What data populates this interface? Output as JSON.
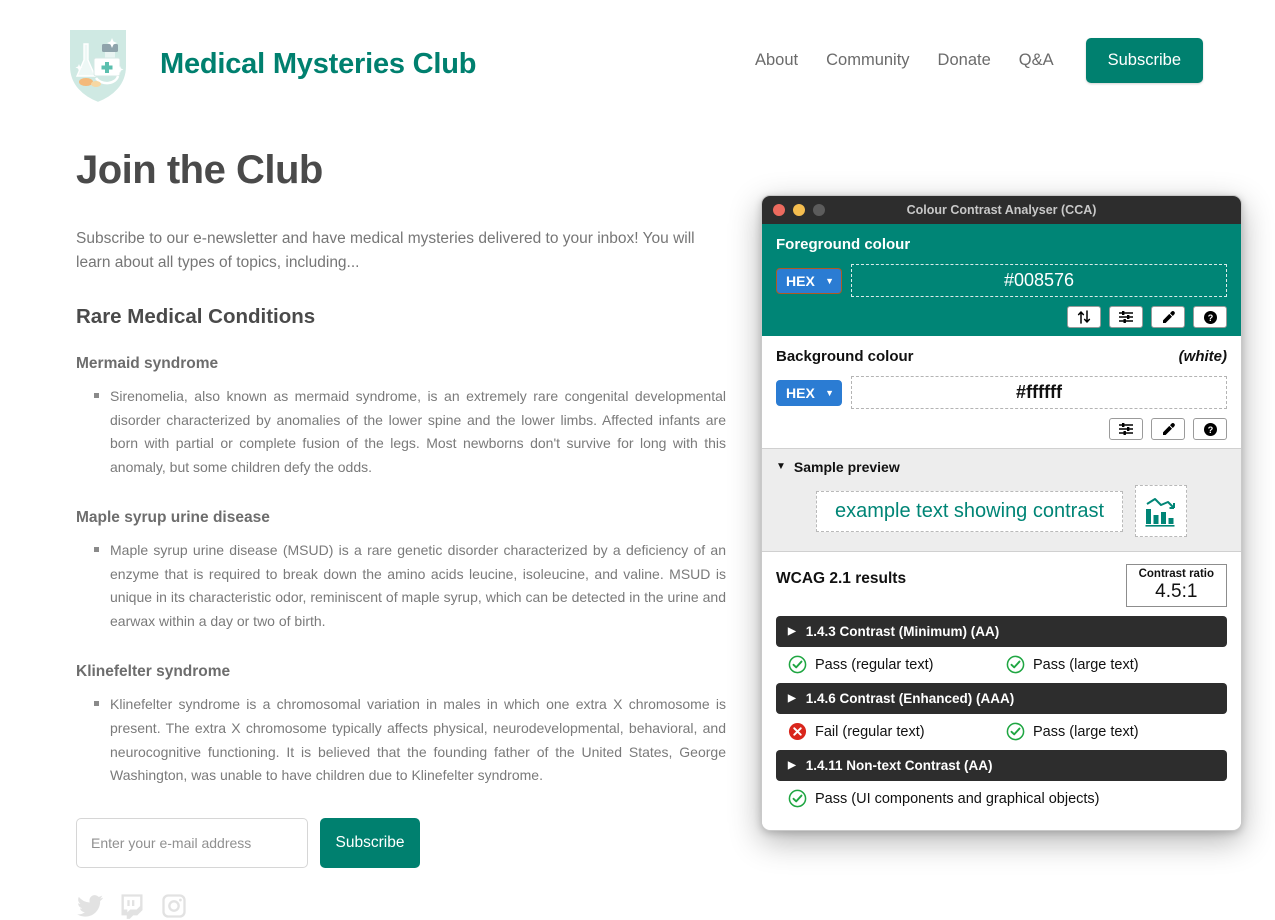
{
  "site": {
    "logo_alt": "medical-shield-logo",
    "brand_title": "Medical Mysteries Club",
    "brand_color": "#00806f",
    "nav": {
      "links": [
        {
          "label": "About"
        },
        {
          "label": "Community"
        },
        {
          "label": "Donate"
        },
        {
          "label": "Q&A"
        }
      ],
      "cta_label": "Subscribe"
    }
  },
  "main": {
    "page_title": "Join the Club",
    "intro": "Subscribe to our e-newsletter and have medical mysteries delivered to your inbox! You will learn about all types of topics, including...",
    "section_title": "Rare Medical Conditions",
    "conditions": [
      {
        "title": "Mermaid syndrome",
        "body": "Sirenomelia, also known as mermaid syndrome, is an extremely rare congenital developmental disorder characterized by anomalies of the lower spine and the lower limbs. Affected infants are born with partial or complete fusion of the legs. Most newborns don't survive for long with this anomaly, but some children defy the odds."
      },
      {
        "title": "Maple syrup urine disease",
        "body": "Maple syrup urine disease (MSUD) is a rare genetic disorder characterized by a deficiency of an enzyme that is required to break down the amino acids leucine, isoleucine, and valine. MSUD is unique in its characteristic odor, reminiscent of maple syrup, which can be detected in the urine and earwax within a day or two of birth."
      },
      {
        "title": "Klinefelter syndrome",
        "body": "Klinefelter syndrome is a chromosomal variation in males in which one extra X chromosome is present. The extra X chromosome typically affects physical, neurodevelopmental, behavioral, and neurocognitive functioning. It is believed that the founding father of the United States, George Washington, was unable to have children due to Klinefelter syndrome."
      }
    ],
    "form": {
      "email_placeholder": "Enter your e-mail address",
      "email_value": "",
      "submit_label": "Subscribe"
    },
    "social": [
      {
        "name": "twitter-icon"
      },
      {
        "name": "twitch-icon"
      },
      {
        "name": "instagram-icon"
      }
    ]
  },
  "cca": {
    "window_title": "Colour Contrast Analyser (CCA)",
    "traffic_lights": [
      "close",
      "minimize",
      "zoom"
    ],
    "foreground": {
      "label": "Foreground colour",
      "format": "HEX",
      "value": "#008576",
      "buttons": [
        "swap-colours-icon",
        "sliders-icon",
        "eyedropper-icon",
        "help-icon"
      ]
    },
    "background": {
      "label": "Background colour",
      "note": "(white)",
      "format": "HEX",
      "value": "#ffffff",
      "buttons": [
        "sliders-icon",
        "eyedropper-icon",
        "help-icon"
      ]
    },
    "preview": {
      "label": "Sample preview",
      "expanded": true,
      "sample_text": "example text showing contrast",
      "sample_graphic": "bar-chart-icon"
    },
    "results": {
      "title": "WCAG 2.1 results",
      "ratio_label": "Contrast ratio",
      "ratio_value": "4.5:1",
      "criteria": [
        {
          "name": "1.4.3 Contrast (Minimum) (AA)",
          "outcomes": [
            {
              "status": "pass",
              "text": "Pass (regular text)"
            },
            {
              "status": "pass",
              "text": "Pass (large text)"
            }
          ]
        },
        {
          "name": "1.4.6 Contrast (Enhanced) (AAA)",
          "outcomes": [
            {
              "status": "fail",
              "text": "Fail (regular text)"
            },
            {
              "status": "pass",
              "text": "Pass (large text)"
            }
          ]
        },
        {
          "name": "1.4.11 Non-text Contrast (AA)",
          "outcomes": [
            {
              "status": "pass",
              "text": "Pass (UI components and graphical objects)"
            }
          ]
        }
      ]
    }
  },
  "colors": {
    "teal": "#008576",
    "brand_teal": "#00806f",
    "pass_green": "#1fa642",
    "fail_red": "#d9261c",
    "titlebar": "#2d2d2d",
    "criterion_bar": "#2d2d2d"
  }
}
